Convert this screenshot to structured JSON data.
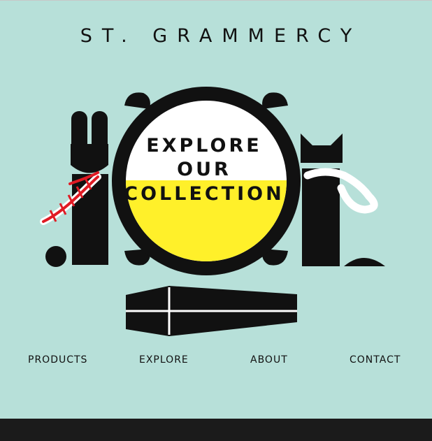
{
  "brand": {
    "name": "ST. GRAMMERCY"
  },
  "hero": {
    "line1": "EXPLORE",
    "line2": "OUR",
    "line3": "COLLECTION"
  },
  "nav": {
    "items": [
      {
        "label": "PRODUCTS"
      },
      {
        "label": "EXPLORE"
      },
      {
        "label": "ABOUT"
      },
      {
        "label": "CONTACT"
      }
    ]
  },
  "colors": {
    "background": "#b7e0d9",
    "ink": "#111111",
    "accent_yellow": "#fff02a",
    "accent_red": "#e01b24",
    "footer": "#1b1b1b"
  }
}
